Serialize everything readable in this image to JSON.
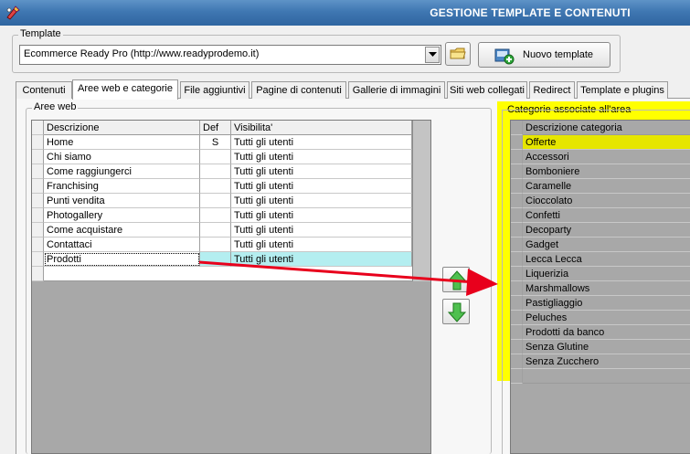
{
  "window": {
    "title": "GESTIONE TEMPLATE E CONTENUTI"
  },
  "template_group": {
    "legend": "Template",
    "selected_template": "Ecommerce Ready Pro (http://www.readyprodemo.it)",
    "new_template_label": "Nuovo template"
  },
  "tabs": [
    {
      "label": "Contenuti",
      "active": false
    },
    {
      "label": "Aree web e categorie",
      "active": true
    },
    {
      "label": "File aggiuntivi",
      "active": false
    },
    {
      "label": "Pagine di contenuti",
      "active": false
    },
    {
      "label": "Gallerie di immagini",
      "active": false
    },
    {
      "label": "Siti web collegati",
      "active": false
    },
    {
      "label": "Redirect",
      "active": false
    },
    {
      "label": "Template e plugins",
      "active": false
    }
  ],
  "areas": {
    "legend": "Aree web",
    "columns": [
      "Descrizione",
      "Def",
      "Visibilita'"
    ],
    "rows": [
      [
        "Home",
        "S",
        "Tutti gli utenti"
      ],
      [
        "Chi siamo",
        "",
        "Tutti gli utenti"
      ],
      [
        "Come raggiungerci",
        "",
        "Tutti gli utenti"
      ],
      [
        "Franchising",
        "",
        "Tutti gli utenti"
      ],
      [
        "Punti vendita",
        "",
        "Tutti gli utenti"
      ],
      [
        "Photogallery",
        "",
        "Tutti gli utenti"
      ],
      [
        "Come acquistare",
        "",
        "Tutti gli utenti"
      ],
      [
        "Contattaci",
        "",
        "Tutti gli utenti"
      ],
      [
        "Prodotti",
        "",
        "Tutti gli utenti"
      ]
    ],
    "selected_row": 8
  },
  "categories": {
    "legend": "Categorie associate all'area",
    "column": "Descrizione categoria",
    "rows": [
      "Offerte",
      "Accessori",
      "Bomboniere",
      "Caramelle",
      "Cioccolato",
      "Confetti",
      "Decoparty",
      "Gadget",
      "Lecca Lecca",
      "Liquerizia",
      "Marshmallows",
      "Pastigliaggio",
      "Peluches",
      "Prodotti da banco",
      "Senza Glutine",
      "Senza Zucchero"
    ],
    "selected_row": 0
  },
  "colors": {
    "title_bar": "#3f77b2",
    "highlight": "#ffff00",
    "selected_row": "#b4eef0",
    "annotation_arrow": "#e8001c"
  },
  "icons": [
    "app-icon",
    "dropdown-arrow-icon",
    "folder-icon",
    "add-icon",
    "arrow-up-icon",
    "arrow-down-icon"
  ]
}
